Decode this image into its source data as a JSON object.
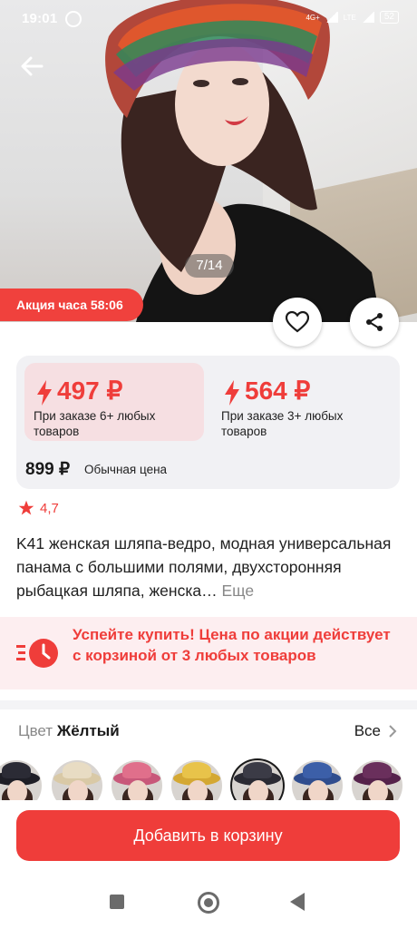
{
  "status_bar": {
    "time": "19:01",
    "network": "4G+",
    "lte": "LTE",
    "battery": "52"
  },
  "gallery": {
    "counter": "7/14",
    "promo_label": "Акция часа 58:06"
  },
  "prices": {
    "tiers": [
      {
        "amount": "497 ₽",
        "condition": "При заказе 6+ любых товаров",
        "selected": true
      },
      {
        "amount": "564 ₽",
        "condition": "При заказе 3+ любых товаров",
        "selected": false
      }
    ],
    "regular_price": "899 ₽",
    "regular_label": "Обычная цена",
    "accent_color": "#ef3d3a"
  },
  "rating": {
    "value": "4,7"
  },
  "product": {
    "title": "K41 женская шляпа-ведро, модная универсальная панама с большими полями, двухсторонняя рыбацкая шляпа, женска…",
    "more_label": "Еще"
  },
  "banner": {
    "text": "Успейте купить! Цена по акции действует с корзиной от 3 любых товаров"
  },
  "color_select": {
    "label": "Цвет",
    "value": "Жёлтый",
    "all_label": "Все",
    "swatches": [
      {
        "hat": "#2b2b35",
        "brim": "#1e1e26"
      },
      {
        "hat": "#e8dcc3",
        "brim": "#d9c9a6"
      },
      {
        "hat": "#e06f8b",
        "brim": "#c8587a"
      },
      {
        "hat": "#e8c34a",
        "brim": "#d4a833"
      },
      {
        "hat": "#3b3b46",
        "brim": "#2a2a33",
        "selected": true
      },
      {
        "hat": "#3c5fa8",
        "brim": "#2f4d8e"
      },
      {
        "hat": "#6a2f5c",
        "brim": "#55224b"
      }
    ]
  },
  "cta": {
    "label": "Добавить в корзину"
  }
}
